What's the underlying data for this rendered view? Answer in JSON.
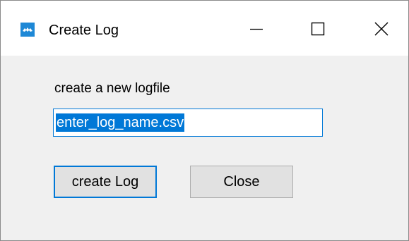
{
  "window": {
    "title": "Create Log",
    "icon": "app-logo-icon",
    "controls": {
      "minimize": "minimize-icon",
      "maximize": "maximize-icon",
      "close": "close-icon"
    }
  },
  "form": {
    "prompt": "create a new logfile",
    "log_name_value": "enter_log_name.csv"
  },
  "buttons": {
    "create_label": "create Log",
    "close_label": "Close"
  },
  "colors": {
    "accent": "#0078d7",
    "button_face": "#e1e1e1",
    "dialog_bg": "#f0f0f0"
  }
}
